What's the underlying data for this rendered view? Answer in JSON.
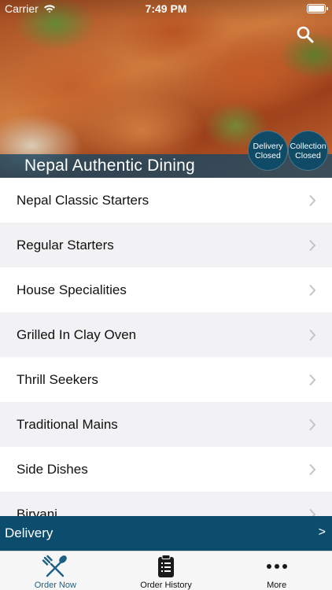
{
  "status_bar": {
    "carrier": "Carrier",
    "time": "7:49 PM"
  },
  "header": {
    "title": "Nepal Authentic Dining",
    "search_icon": "search-icon",
    "delivery_status": {
      "line1": "Delivery",
      "line2": "Closed"
    },
    "collection_status": {
      "line1": "Collection",
      "line2": "Closed"
    }
  },
  "menu": {
    "categories": [
      "Nepal Classic Starters",
      "Regular Starters",
      "House Specialities",
      "Grilled In Clay Oven",
      "Thrill Seekers",
      "Traditional Mains",
      "Side Dishes",
      "Biryani"
    ]
  },
  "delivery_bar": {
    "label": "Delivery",
    "arrow": ">"
  },
  "tabs": [
    {
      "label": "Order Now",
      "icon": "fork-knife-icon",
      "active": true
    },
    {
      "label": "Order History",
      "icon": "clipboard-icon",
      "active": false
    },
    {
      "label": "More",
      "icon": "more-dots-icon",
      "active": false
    }
  ],
  "colors": {
    "brand": "#0c4d6e",
    "active_tab": "#1d5f86",
    "row_alt": "#f2f2f4"
  }
}
